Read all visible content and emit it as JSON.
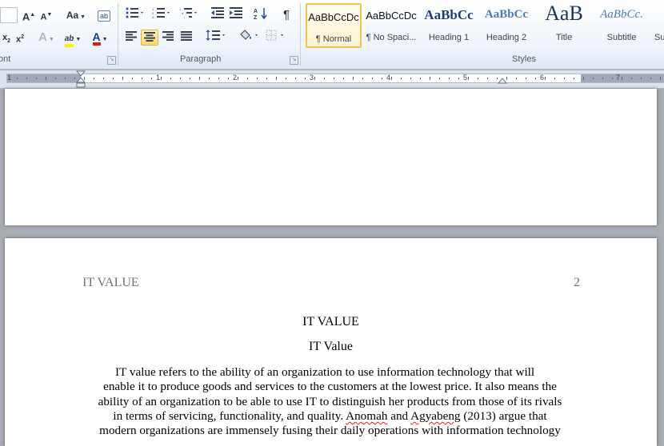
{
  "ribbon": {
    "font_group_label": "ont",
    "paragraph_group_label": "Paragraph",
    "styles_group_label": "Styles",
    "font_buttons": {
      "grow_font": "A",
      "shrink_font": "A",
      "change_case": "Aa",
      "subscript": "x",
      "subscript_mark": "2",
      "superscript": "x",
      "superscript_mark": "2",
      "text_effects": "A",
      "highlight": "ab",
      "font_color": "A"
    },
    "paragraph_buttons": {
      "show_marks": "¶"
    },
    "styles": [
      {
        "preview": "AaBbCcDc",
        "name": "¶ Normal",
        "selected": true
      },
      {
        "preview": "AaBbCcDc",
        "name": "¶ No Spaci...",
        "selected": false
      },
      {
        "preview": "AaBbCc",
        "name": "Heading 1",
        "selected": false
      },
      {
        "preview": "AaBbCc",
        "name": "Heading 2",
        "selected": false
      },
      {
        "preview": "AaB",
        "name": "Title",
        "selected": false
      },
      {
        "preview": "AaBbCc.",
        "name": "Subtitle",
        "selected": false
      },
      {
        "preview": "",
        "name": "Su",
        "selected": false
      }
    ]
  },
  "ruler": {
    "numbers": [
      "1",
      "1",
      "2",
      "3",
      "4",
      "5",
      "6",
      "7"
    ]
  },
  "document": {
    "page2": {
      "header_left": "IT VALUE",
      "header_right": "2",
      "title": "IT VALUE",
      "subtitle": "IT Value",
      "paragraph_lines": [
        "IT value refers to the ability of an organization to use information technology that will",
        "enable it to produce goods and services  to the customers at the lowest price.  It also means the",
        "ability of an organization to be able to use IT to distinguish her products from those of its rivals",
        "in terms of servicing,  functionality, and quality.",
        "modern organizations are immensely  fusing their daily operations with information technology"
      ],
      "line4_citation_a": "Anomah",
      "line4_and": " and ",
      "line4_citation_b": "Agyabeng",
      "line4_tail": " (2013)  argue that"
    }
  }
}
